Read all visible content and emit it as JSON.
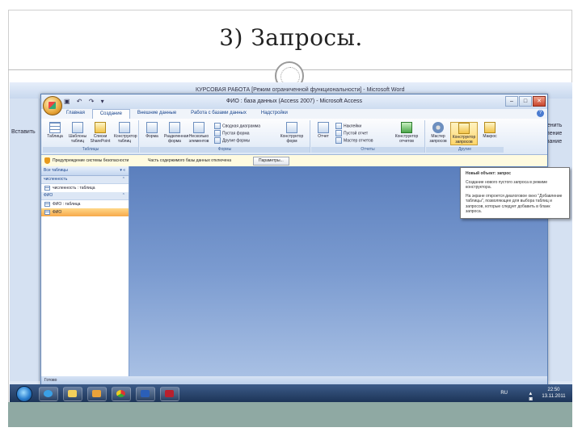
{
  "slide": {
    "title": "3) Запросы."
  },
  "word_window": {
    "title": "КУРСОВАЯ РАБОТА [Режим ограниченной функциональности] - Microsoft Word",
    "left_labels": [
      "Вставить"
    ],
    "right_labels": [
      "менить",
      "еление",
      "ование"
    ]
  },
  "access_window": {
    "title": "ФИО : база данных (Access 2007) - Microsoft Access",
    "tabs": [
      "Главная",
      "Создание",
      "Внешние данные",
      "Работа с базами данных",
      "Надстройки"
    ],
    "active_tab": "Создание",
    "ribbon": {
      "tables_group": {
        "label": "Таблицы",
        "buttons": [
          "Таблица",
          "Шаблоны таблиц",
          "Списки SharePoint",
          "Конструктор таблиц"
        ]
      },
      "forms_group": {
        "label": "Формы",
        "buttons": [
          "Форма",
          "Разделенная форма",
          "Несколько элементов"
        ],
        "small_items": [
          "Сводная диаграмма",
          "Пустая форма",
          "Другие формы"
        ],
        "designer": "Конструктор форм"
      },
      "reports_group": {
        "label": "Отчеты",
        "buttons": [
          "Отчет"
        ],
        "small_items": [
          "Наклейки",
          "Пустой отчет",
          "Мастер отчетов"
        ],
        "designer": "Конструктор отчетов"
      },
      "other_group": {
        "label": "Другие",
        "buttons": [
          "Мастер запросов",
          "Конструктор запросов",
          "Макрос"
        ]
      }
    },
    "message_bar": {
      "text": "Предупреждение системы безопасности",
      "sub": "Часть содержимого базы данных отключена",
      "button": "Параметры..."
    },
    "nav_pane": {
      "header": "Все таблицы",
      "groups": [
        {
          "name": "численность",
          "items": [
            {
              "label": "численность : таблица",
              "selected": false
            }
          ]
        },
        {
          "name": "ФИО",
          "items": [
            {
              "label": "ФИО : таблица",
              "selected": false
            },
            {
              "label": "ФИО",
              "selected": true
            }
          ]
        }
      ]
    },
    "status": "Готово",
    "tooltip": {
      "title": "Новый объект: запрос",
      "p1": "Создание нового пустого запроса в режиме конструктора.",
      "p2": "На экране откроется диалоговое окно \"Добавление таблицы\", позволяющее для выбора таблиц и запросов, которые следует добавить в бланк запроса."
    }
  },
  "taskbar": {
    "lang": "RU",
    "time": "22:50",
    "date": "13.11.2011"
  }
}
